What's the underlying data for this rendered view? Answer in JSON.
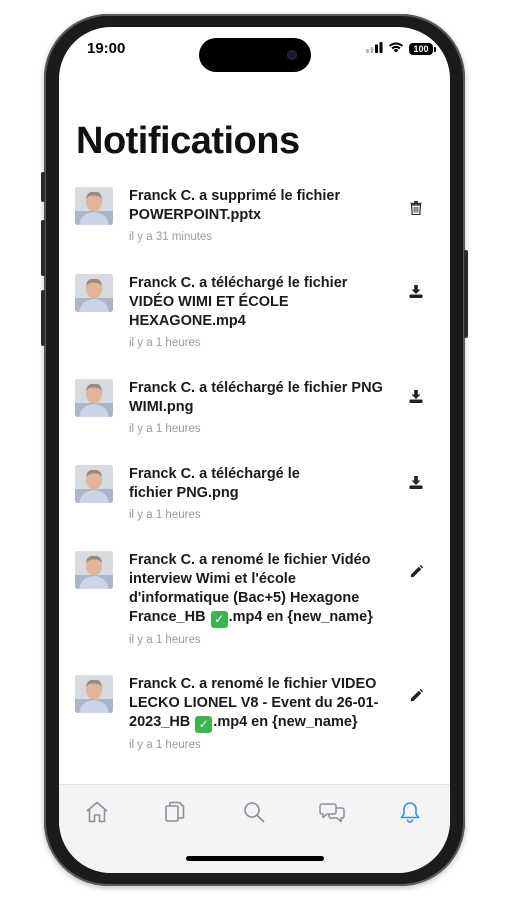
{
  "status_bar": {
    "time": "19:00",
    "battery": "100"
  },
  "page": {
    "title": "Notifications"
  },
  "notifications": [
    {
      "text": "Franck C. a supprimé le fichier POWERPOINT.pptx",
      "time": "il y a 31 minutes",
      "action_icon": "trash-icon"
    },
    {
      "text": "Franck C. a téléchargé le fichier VIDÉO WIMI ET ÉCOLE HEXAGONE.mp4",
      "time": "il y a 1 heures",
      "action_icon": "download-icon"
    },
    {
      "text": "Franck C. a téléchargé le fichier PNG WIMI.png",
      "time": "il y a 1 heures",
      "action_icon": "download-icon"
    },
    {
      "text": "Franck C. a téléchargé le fichier PNG.png",
      "time": "il y a 1 heures",
      "action_icon": "download-icon"
    },
    {
      "text_before": "Franck C. a renomé le fichier Vidéo interview Wimi et l'école d'informatique (Bac+5) Hexagone France_HB ",
      "emoji": "✓",
      "text_after": ".mp4 en {new_name}",
      "time": "il y a 1 heures",
      "action_icon": "pencil-icon"
    },
    {
      "text_before": "Franck C. a renomé le fichier VIDEO LECKO LIONEL V8 - Event du 26-01-2023_HB ",
      "emoji": "✓",
      "text_after": ".mp4 en {new_name}",
      "time": "il y a 1 heures",
      "action_icon": "pencil-icon"
    }
  ],
  "tab_bar": {
    "tabs": [
      {
        "icon": "home-icon",
        "active": false
      },
      {
        "icon": "documents-icon",
        "active": false
      },
      {
        "icon": "search-icon",
        "active": false
      },
      {
        "icon": "chat-icon",
        "active": false
      },
      {
        "icon": "bell-icon",
        "active": true
      }
    ]
  },
  "colors": {
    "active_tab": "#3b8fe0",
    "inactive_tab": "#8e8e93",
    "check_emoji": "#3fb34f",
    "time_text": "#9a9a9a"
  }
}
